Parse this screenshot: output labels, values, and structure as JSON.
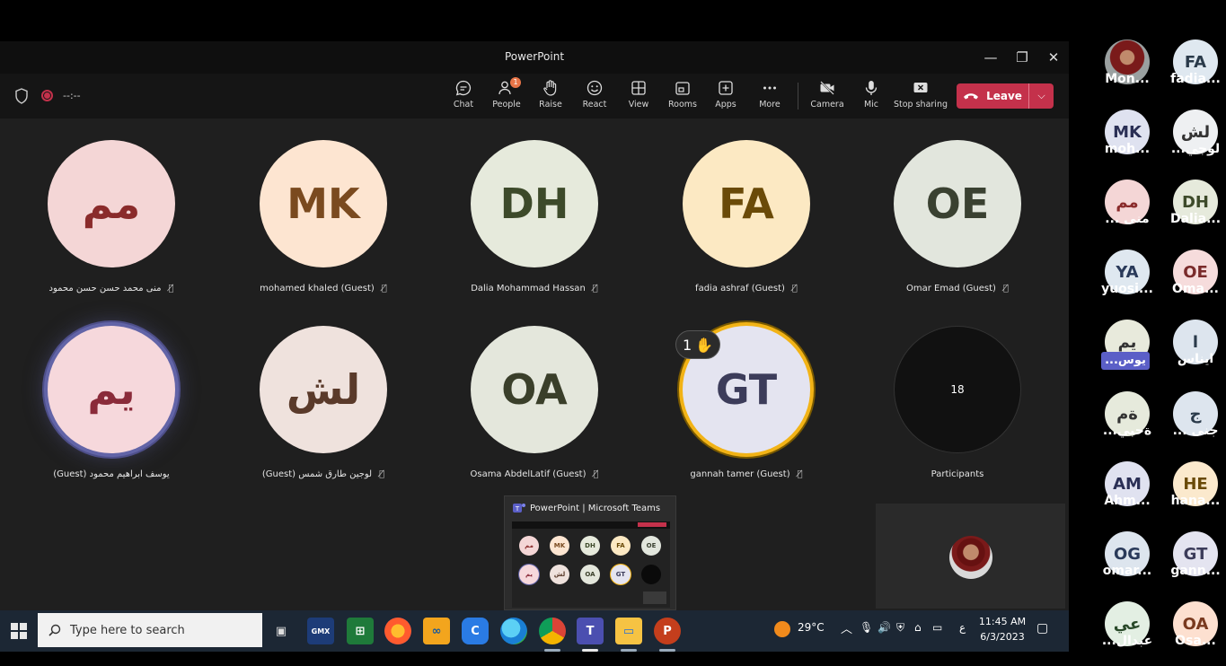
{
  "window": {
    "title": "PowerPoint",
    "minimize": "—",
    "maximize": "❐",
    "close": "✕"
  },
  "call": {
    "timer": "--:--"
  },
  "toolbar": {
    "chat": "Chat",
    "people": "People",
    "people_badge": "1",
    "raise": "Raise",
    "react": "React",
    "view": "View",
    "rooms": "Rooms",
    "apps": "Apps",
    "more": "More",
    "camera": "Camera",
    "mic": "Mic",
    "stop_sharing": "Stop sharing",
    "leave": "Leave"
  },
  "tiles": [
    {
      "initials": "مم",
      "name": "منى محمد حسن حسن محمود",
      "bg": "#f4d6d6",
      "fg": "#8a2b2b"
    },
    {
      "initials": "MK",
      "name": "mohamed khaled (Guest)",
      "bg": "#fde5d1",
      "fg": "#7a4a1f"
    },
    {
      "initials": "DH",
      "name": "Dalia Mohammad Hassan",
      "bg": "#e6eadc",
      "fg": "#3d4a2a"
    },
    {
      "initials": "FA",
      "name": "fadia ashraf (Guest)",
      "bg": "#fce9c3",
      "fg": "#6a4a08"
    },
    {
      "initials": "OE",
      "name": "Omar Emad (Guest)",
      "bg": "#e2e6dd",
      "fg": "#3a4131"
    },
    {
      "initials": "يم",
      "name": "(Guest) يوسف ابراهيم محمود",
      "bg": "#f6d8dc",
      "fg": "#8a2b3a"
    },
    {
      "initials": "لش",
      "name": "(Guest) لوجين طارق شمس",
      "bg": "#efe2dd",
      "fg": "#5a3a2a"
    },
    {
      "initials": "OA",
      "name": "Osama AbdelLatif (Guest)",
      "bg": "#e4e7dc",
      "fg": "#3a3f2a"
    },
    {
      "initials": "GT",
      "name": "gannah tamer (Guest)",
      "bg": "#e4e4f0",
      "fg": "#3c3c5a"
    },
    {
      "initials": "18",
      "name": "Participants",
      "bg": "#111111",
      "fg": "#ffffff"
    }
  ],
  "raised_hand": {
    "count": "1",
    "icon": "✋"
  },
  "thumbnail": {
    "title": "PowerPoint | Microsoft Teams"
  },
  "sidebar": [
    {
      "initials": "",
      "name": "Mon...",
      "bg": "#c9c9c9",
      "fg": "#333"
    },
    {
      "initials": "FA",
      "name": "fadia...",
      "bg": "#dfe8f0",
      "fg": "#2a3a4a"
    },
    {
      "initials": "MK",
      "name": "moh...",
      "bg": "#dfe2f0",
      "fg": "#2a2f55"
    },
    {
      "initials": "لش",
      "name": "...لوجي",
      "bg": "#eef0f2",
      "fg": "#333"
    },
    {
      "initials": "مم",
      "name": "... منى",
      "bg": "#f4d6d6",
      "fg": "#8a2b2b"
    },
    {
      "initials": "DH",
      "name": "Dalia...",
      "bg": "#e6eadc",
      "fg": "#3d4a2a"
    },
    {
      "initials": "YA",
      "name": "yuosi...",
      "bg": "#dfe8f0",
      "fg": "#2a3a5a"
    },
    {
      "initials": "OE",
      "name": "Oma...",
      "bg": "#f6dcdc",
      "fg": "#7a2b2b"
    },
    {
      "initials": "يم",
      "name": "...يوس",
      "bg": "#e8eadc",
      "fg": "#333"
    },
    {
      "initials": "ا",
      "name": "ايناس",
      "bg": "#dde5ee",
      "fg": "#2a3a4a"
    },
    {
      "initials": "ةم",
      "name": "...ةحبي",
      "bg": "#e6eadc",
      "fg": "#333"
    },
    {
      "initials": "ج",
      "name": "... جنى",
      "bg": "#dde5ee",
      "fg": "#2a3a4a"
    },
    {
      "initials": "AM",
      "name": "Ahm...",
      "bg": "#e0e2f0",
      "fg": "#2a2f55"
    },
    {
      "initials": "HE",
      "name": "hana...",
      "bg": "#fbe9cd",
      "fg": "#6a4a08"
    },
    {
      "initials": "OG",
      "name": "omar...",
      "bg": "#dde5ee",
      "fg": "#2a3a5a"
    },
    {
      "initials": "GT",
      "name": "gann...",
      "bg": "#e4e4f0",
      "fg": "#3c3c5a"
    },
    {
      "initials": "عي",
      "name": "...عبدال",
      "bg": "#e3efe3",
      "fg": "#2a4a2a"
    },
    {
      "initials": "OA",
      "name": "Osa...",
      "bg": "#fde0d0",
      "fg": "#7a3a1f"
    }
  ],
  "taskbar": {
    "search_placeholder": "Type here to search",
    "weather": "29°C",
    "lang": "ع",
    "time": "11:45 AM",
    "date": "6/3/2023"
  }
}
